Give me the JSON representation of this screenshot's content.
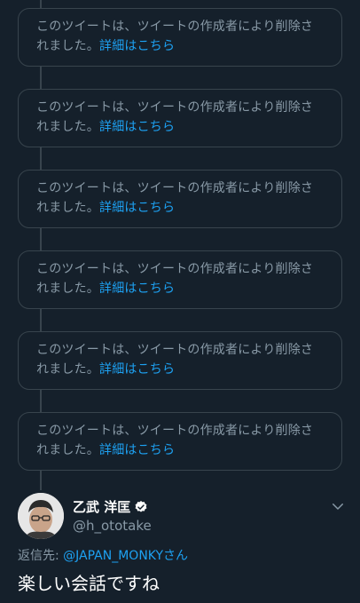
{
  "deleted_tweets": [
    {
      "line1": "このツイートは、ツイートの作成者により削除さ",
      "line2_prefix": "れました。",
      "link": "詳細はこちら"
    },
    {
      "line1": "このツイートは、ツイートの作成者により削除さ",
      "line2_prefix": "れました。",
      "link": "詳細はこちら"
    },
    {
      "line1": "このツイートは、ツイートの作成者により削除さ",
      "line2_prefix": "れました。",
      "link": "詳細はこちら"
    },
    {
      "line1": "このツイートは、ツイートの作成者により削除さ",
      "line2_prefix": "れました。",
      "link": "詳細はこちら"
    },
    {
      "line1": "このツイートは、ツイートの作成者により削除さ",
      "line2_prefix": "れました。",
      "link": "詳細はこちら"
    },
    {
      "line1": "このツイートは、ツイートの作成者により削除さ",
      "line2_prefix": "れました。",
      "link": "詳細はこちら"
    }
  ],
  "tweet": {
    "display_name": "乙武 洋匡",
    "handle": "@h_ototake",
    "verified": true,
    "reply_prefix": "返信先: ",
    "reply_mention": "@JAPAN_MONKY",
    "reply_suffix": "さん",
    "text": "楽しい会話ですね"
  },
  "colors": {
    "background": "#15202b",
    "border": "#38444d",
    "muted_text": "#8899a6",
    "link": "#1da1f2",
    "primary_text": "#ffffff"
  },
  "icons": {
    "verified": "verified-badge-icon",
    "more": "chevron-down-icon"
  }
}
